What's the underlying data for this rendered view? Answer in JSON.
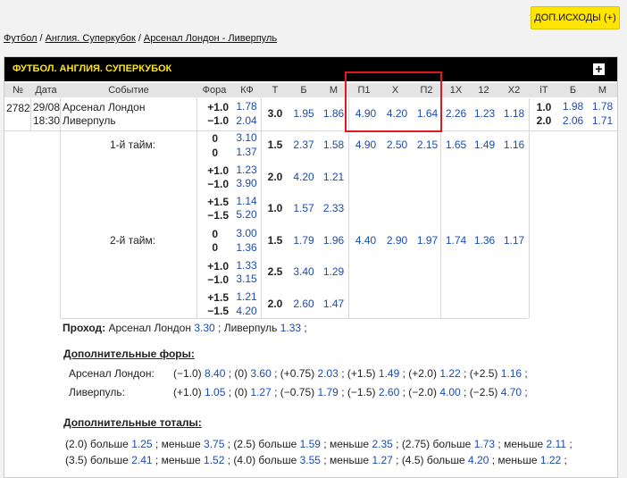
{
  "topbar": {
    "more_button": "ДОП.ИСХОДЫ (+)",
    "crumbs": [
      "Футбол",
      "Англия. Суперкубок",
      "Арсенал Лондон - Ливерпуль"
    ],
    "sep": "/"
  },
  "panel": {
    "title": "ФУТБОЛ. АНГЛИЯ. СУПЕРКУБОК",
    "plus": "+",
    "headers": [
      "№",
      "Дата",
      "Событие",
      "Фора",
      "КФ",
      "Т",
      "Б",
      "М",
      "П1",
      "X",
      "П2",
      "1X",
      "12",
      "X2",
      "iT",
      "Б",
      "М"
    ]
  },
  "main_row": {
    "num": "2782",
    "date": "29/08",
    "time": "18:30",
    "team1": "Арсенал Лондон",
    "team2": "Ливерпуль",
    "fora1": "+1.0",
    "fora2": "−1.0",
    "kf1": "1.78",
    "kf2": "2.04",
    "t": "3.0",
    "b": "1.95",
    "m": "1.86",
    "p1": "4.90",
    "x": "4.20",
    "p2": "1.64",
    "x1": "2.26",
    "x12": "1.23",
    "x2": "1.18",
    "it1": "1.0",
    "it2": "2.0",
    "ib1": "1.98",
    "ib2": "2.06",
    "im1": "1.78",
    "im2": "1.71"
  },
  "half1": {
    "label": "1-й тайм:",
    "f": [
      [
        "0",
        "0"
      ],
      [
        "+1.0",
        "−1.0"
      ],
      [
        "+1.5",
        "−1.5"
      ]
    ],
    "k": [
      [
        "3.10",
        "1.37"
      ],
      [
        "1.23",
        "3.90"
      ],
      [
        "1.14",
        "5.20"
      ]
    ],
    "t": [
      [
        "1.5",
        "2.37",
        "1.58"
      ],
      [
        "2.0",
        "4.20",
        "1.21"
      ],
      [
        "1.0",
        "1.57",
        "2.33"
      ]
    ],
    "res": [
      "4.90",
      "2.50",
      "2.15",
      "1.65",
      "1.49",
      "1.16"
    ]
  },
  "half2": {
    "label": "2-й тайм:",
    "f": [
      [
        "0",
        "0"
      ],
      [
        "+1.0",
        "−1.0"
      ],
      [
        "+1.5",
        "−1.5"
      ]
    ],
    "k": [
      [
        "3.00",
        "1.36"
      ],
      [
        "1.33",
        "3.15"
      ],
      [
        "1.21",
        "4.20"
      ]
    ],
    "t": [
      [
        "1.5",
        "1.79",
        "1.96"
      ],
      [
        "2.5",
        "3.40",
        "1.29"
      ],
      [
        "2.0",
        "2.60",
        "1.47"
      ]
    ],
    "res": [
      "4.40",
      "2.90",
      "1.97",
      "1.74",
      "1.36",
      "1.17"
    ]
  },
  "pass": {
    "label": "Проход:",
    "team1": "Арсенал Лондон",
    "odd1": "3.30",
    "team2": "Ливерпуль",
    "odd2": "1.33"
  },
  "extra_fora": {
    "title": "Дополнительные форы:",
    "team1": "Арсенал Лондон:",
    "team2": "Ливерпуль:",
    "row1": [
      [
        "(−1.0)",
        "8.40"
      ],
      [
        "(0)",
        "3.60"
      ],
      [
        "(+0.75)",
        "2.03"
      ],
      [
        "(+1.5)",
        "1.49"
      ],
      [
        "(+2.0)",
        "1.22"
      ],
      [
        "(+2.5)",
        "1.16"
      ]
    ],
    "row2": [
      [
        "(+1.0)",
        "1.05"
      ],
      [
        "(0)",
        "1.27"
      ],
      [
        "(−0.75)",
        "1.79"
      ],
      [
        "(−1.5)",
        "2.60"
      ],
      [
        "(−2.0)",
        "4.00"
      ],
      [
        "(−2.5)",
        "4.70"
      ]
    ]
  },
  "extra_totals": {
    "title": "Дополнительные тоталы:",
    "row1": [
      [
        "(2.0) больше",
        "1.25"
      ],
      [
        "меньше",
        "3.75"
      ],
      [
        "(2.5) больше",
        "1.59"
      ],
      [
        "меньше",
        "2.35"
      ],
      [
        "(2.75) больше",
        "1.73"
      ],
      [
        "меньше",
        "2.11"
      ]
    ],
    "row2": [
      [
        "(3.5) больше",
        "2.41"
      ],
      [
        "меньше",
        "1.52"
      ],
      [
        "(4.0) больше",
        "3.55"
      ],
      [
        "меньше",
        "1.27"
      ],
      [
        "(4.5) больше",
        "4.20"
      ],
      [
        "меньше",
        "1.22"
      ]
    ]
  }
}
